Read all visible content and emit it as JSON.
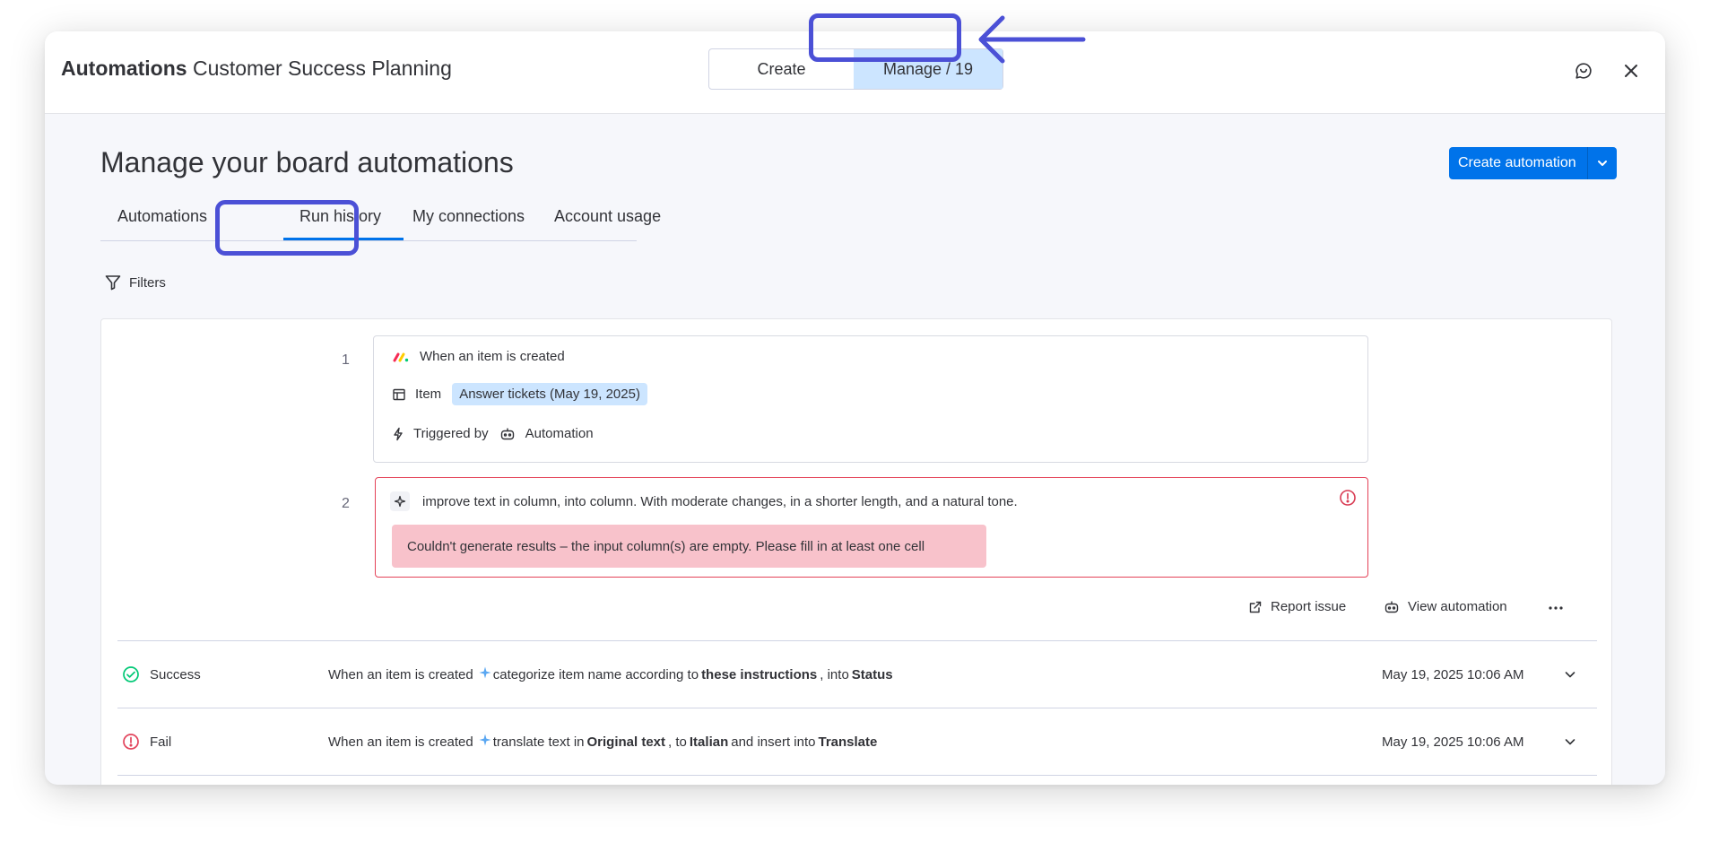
{
  "header": {
    "title_bold": "Automations",
    "title_rest": "Customer Success Planning",
    "seg_create": "Create",
    "seg_manage": "Manage / 19"
  },
  "page": {
    "title": "Manage your board automations",
    "create_button": "Create automation",
    "filters": "Filters"
  },
  "tabs": [
    "Automations",
    "Run history",
    "My connections",
    "Account usage"
  ],
  "run_detail": {
    "step1": {
      "number": "1",
      "trigger": "When an item is created",
      "item_label": "Item",
      "item_value": "Answer tickets (May 19, 2025)",
      "triggered_by_label": "Triggered by",
      "triggered_by_value": "Automation"
    },
    "step2": {
      "number": "2",
      "action": "improve text in column, into column. With moderate changes, in a shorter length, and a natural tone.",
      "error": "Couldn't generate results – the input column(s) are empty. Please fill in at least one cell"
    },
    "report_issue": "Report issue",
    "view_automation": "View automation"
  },
  "runs": [
    {
      "status": "Success",
      "trigger": "When an item is created",
      "action": "categorize",
      "mid": "item name according to",
      "bold1": "these instructions",
      "mid2": ", into",
      "bold2": "Status",
      "mid3": "",
      "bold3": "",
      "timestamp": "May 19, 2025 10:06 AM"
    },
    {
      "status": "Fail",
      "trigger": "When an item is created",
      "action": "translate text",
      "mid": "in",
      "bold1": "Original text",
      "mid2": ", to",
      "bold2": "Italian",
      "mid3": "and insert into",
      "bold3": "Translate",
      "timestamp": "May 19, 2025 10:06 AM"
    }
  ],
  "colors": {
    "accent": "#0073ea",
    "highlight": "#4b50d6",
    "success": "#00c875",
    "fail": "#e2445c",
    "chip": "#cce5ff",
    "error_bg": "#f8c2cb"
  }
}
